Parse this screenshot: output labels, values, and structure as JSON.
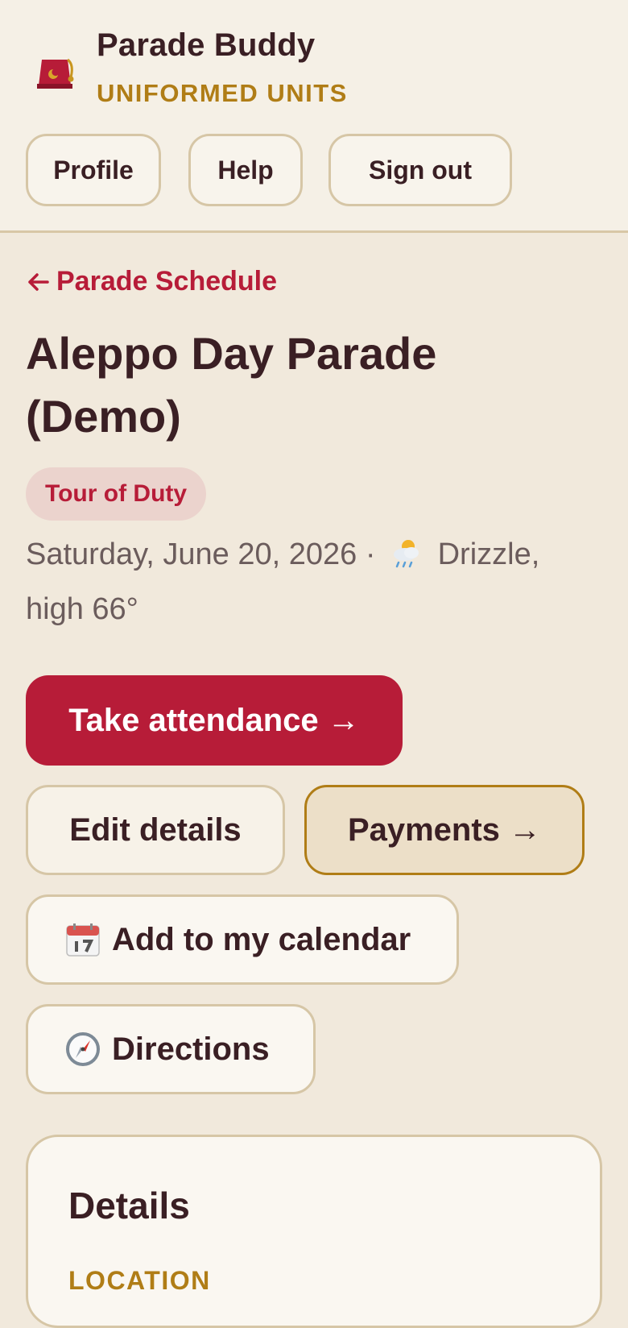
{
  "brand": {
    "title": "Parade Buddy",
    "subtitle": "UNIFORMED UNITS",
    "logo_icon": "fez-icon"
  },
  "nav": {
    "profile": "Profile",
    "help": "Help",
    "sign_out": "Sign out"
  },
  "back_link": {
    "label": "Parade Schedule",
    "icon": "arrow-left-icon"
  },
  "event": {
    "title": "Aleppo Day Parade (Demo)",
    "badge": "Tour of Duty",
    "date": "Saturday, June 20, 2026",
    "separator": "·",
    "weather_icon": "sun-cloud-rain-icon",
    "weather": "Drizzle, high 66°"
  },
  "actions": {
    "take_attendance": "Take attendance →",
    "edit_details": "Edit details",
    "payments": "Payments →",
    "add_calendar": "Add to my calendar",
    "directions": "Directions"
  },
  "details": {
    "title": "Details",
    "location_label": "LOCATION"
  },
  "colors": {
    "accent": "#b71c38",
    "gold": "#b07d16",
    "text": "#3a1f24",
    "background": "#f1e9dc"
  }
}
